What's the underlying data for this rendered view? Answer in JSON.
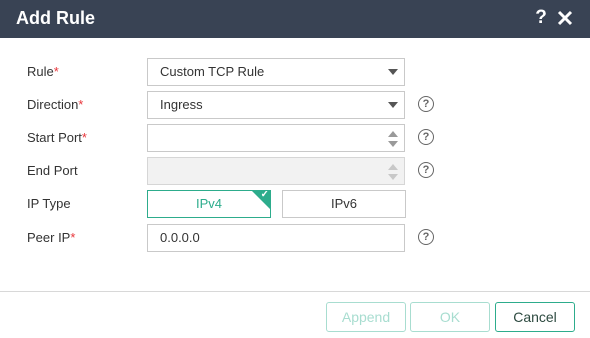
{
  "dialog": {
    "title": "Add Rule",
    "help_icon": "question-icon",
    "close_icon": "close-icon"
  },
  "form": {
    "required_marker": "*",
    "rule": {
      "label": "Rule",
      "value": "Custom TCP Rule"
    },
    "direction": {
      "label": "Direction",
      "value": "Ingress"
    },
    "start_port": {
      "label": "Start Port",
      "value": ""
    },
    "end_port": {
      "label": "End Port",
      "value": ""
    },
    "ip_type": {
      "label": "IP Type",
      "options": [
        "IPv4",
        "IPv6"
      ],
      "selected": "IPv4"
    },
    "peer_ip": {
      "label": "Peer IP",
      "value": "0.0.0.0"
    },
    "field_help_glyph": "?"
  },
  "buttons": {
    "append": "Append",
    "ok": "OK",
    "cancel": "Cancel"
  },
  "colors": {
    "titlebar": "#394354",
    "accent": "#2dac8c",
    "required": "#e8353a",
    "disabled_button_text": "#a8ddd0"
  }
}
